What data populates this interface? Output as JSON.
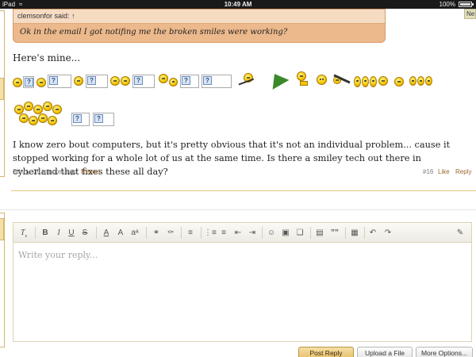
{
  "status_bar": {
    "device": "iPad",
    "time": "10:49 AM",
    "battery": "100%"
  },
  "badge": {
    "label": "Ne"
  },
  "quote": {
    "author": "clemsonfor said: ↑",
    "text": "Ok in the email I got notifing me the broken smiles were working?"
  },
  "post": {
    "intro": "Here's mine...",
    "body": "I know zero bout computers, but it's pretty obvious that it's not an individual problem... cause it stopped working for a whole lot of us at the same time. Is there a smiley tech out there in cyberland that fixes these all day?",
    "author_time": "Stinny, 35 minutes ago",
    "report": "Report",
    "number": "#16",
    "like": "Like",
    "reply": "Reply",
    "broken_glyph": "?"
  },
  "editor": {
    "placeholder": "Write your reply...",
    "toolbar_icons": [
      "clear-format-icon",
      "bold-icon",
      "italic-icon",
      "underline-icon",
      "strikethrough-icon",
      "text-color-icon",
      "font-size-icon",
      "font-family-icon",
      "link-icon",
      "unlink-icon",
      "align-icon",
      "bullet-list-icon",
      "numbered-list-icon",
      "outdent-icon",
      "indent-icon",
      "smilie-icon",
      "image-icon",
      "media-icon",
      "code-icon",
      "quote-icon",
      "save-draft-icon",
      "undo-icon",
      "redo-icon",
      "switch-editor-icon"
    ],
    "labels": {
      "bold": "B",
      "italic": "I",
      "underline": "U",
      "strike": "S",
      "text_color": "A",
      "font_size": "A⁲",
      "font_family": "aᵃ",
      "quote": "””"
    }
  },
  "buttons": {
    "post_reply": "Post Reply",
    "upload": "Upload a File",
    "more": "More Options..."
  }
}
